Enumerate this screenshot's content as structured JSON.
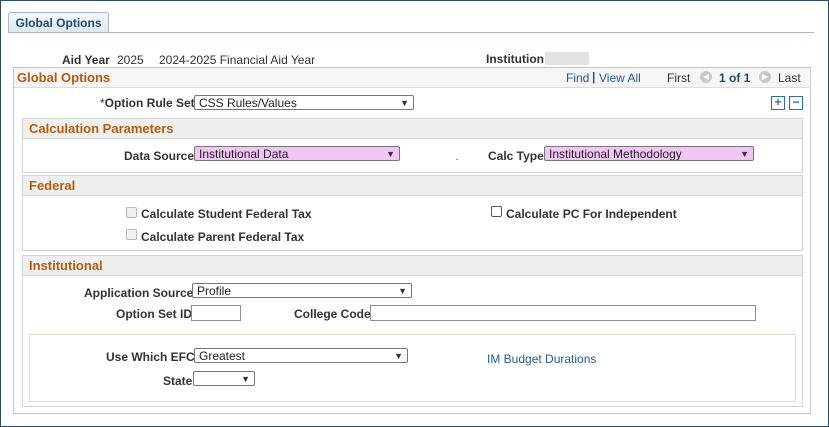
{
  "tab": {
    "label": "Global Options"
  },
  "header": {
    "aid_year_label": "Aid Year",
    "aid_year_value": "2025",
    "aid_year_desc": "2024-2025 Financial Aid Year",
    "institution_label": "Institution",
    "institution_value": ""
  },
  "panel": {
    "title": "Global Options",
    "find_label": "Find",
    "separator": "|",
    "view_all_label": "View All",
    "first_label": "First",
    "page_indicator": "1 of 1",
    "last_label": "Last",
    "option_rule_required_mark": "*",
    "option_rule_label": "Option Rule Set",
    "option_rule_value": "CSS Rules/Values",
    "add_row_symbol": "+",
    "delete_row_symbol": "−"
  },
  "calc_params": {
    "title": "Calculation Parameters",
    "data_source_label": "Data Source",
    "data_source_value": "Institutional Data",
    "calc_type_label": "Calc Type",
    "calc_type_value": "Institutional Methodology"
  },
  "federal": {
    "title": "Federal",
    "calc_student_tax_label": "Calculate Student Federal Tax",
    "calc_parent_tax_label": "Calculate Parent Federal Tax",
    "calc_pc_independent_label": "Calculate PC For Independent"
  },
  "institutional": {
    "title": "Institutional",
    "app_source_label": "Application Source",
    "app_source_value": "Profile",
    "option_set_id_label": "Option Set ID",
    "option_set_id_value": "",
    "college_code_label": "College Code",
    "college_code_value": "",
    "use_which_efc_label": "Use Which EFC",
    "use_which_efc_value": "Greatest",
    "im_budget_link": "IM Budget Durations",
    "state_label": "State",
    "state_value": ""
  }
}
